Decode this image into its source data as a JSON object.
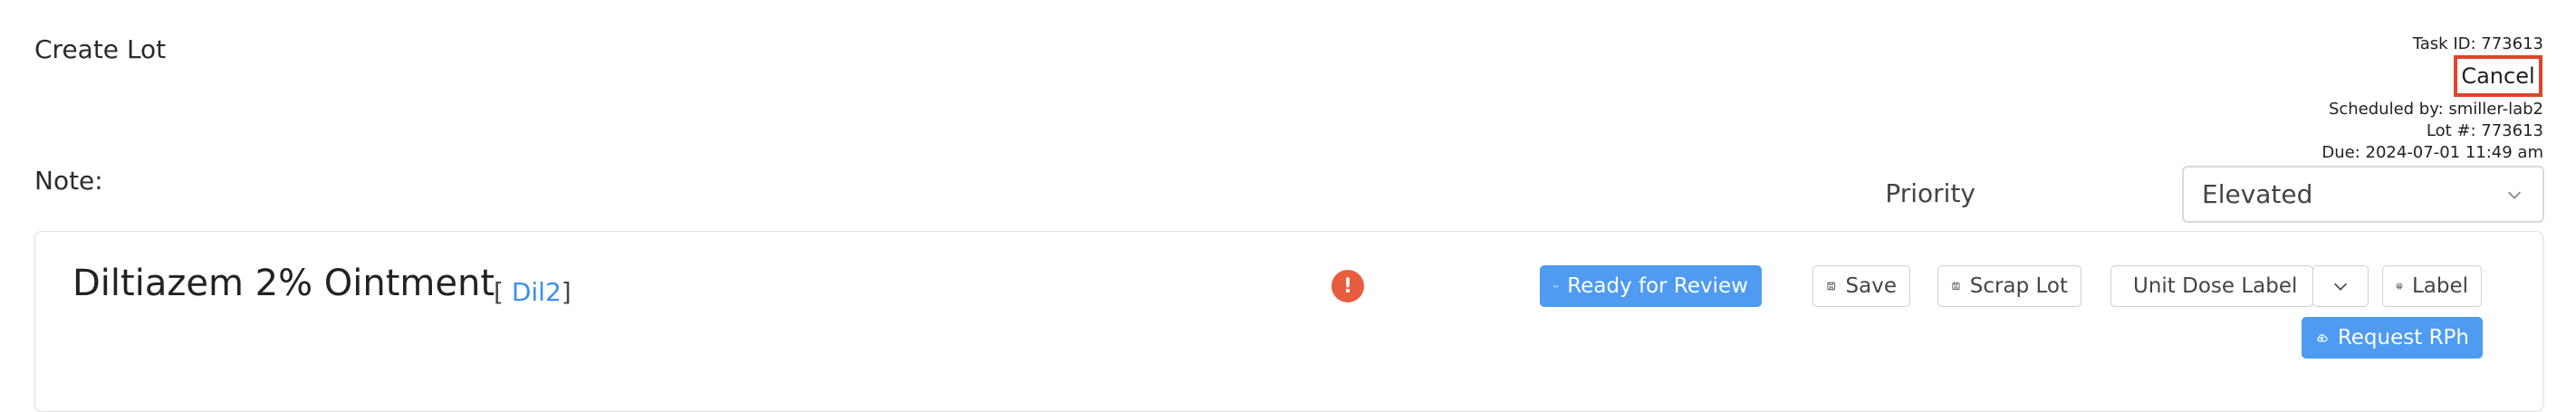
{
  "header": {
    "title": "Create Lot",
    "note_label": "Note:"
  },
  "meta": {
    "task_id": "Task ID: 773613",
    "cancel_label": "Cancel",
    "scheduled_by": "Scheduled by: smiller-lab2",
    "lot_number": "Lot #: 773613",
    "due": "Due: 2024-07-01 11:49 am"
  },
  "priority": {
    "label": "Priority",
    "value": "Elevated"
  },
  "lot": {
    "drug_name": "Diltiazem 2% Ointment",
    "code_open": "[ ",
    "code": "Dil2",
    "code_close": "]"
  },
  "actions": {
    "ready_for_review": "Ready for Review",
    "save": "Save",
    "scrap_lot": "Scrap Lot",
    "unit_dose_label": "Unit Dose Label",
    "label": "Label",
    "request_rph": "Request RPh"
  },
  "icons": {
    "alert": "alert-icon",
    "review": "glasses-icon",
    "save": "floppy-icon",
    "scrap": "floppy-icon",
    "dropdown": "chevron-down-icon",
    "label": "printer-icon",
    "request": "cloud-icon"
  },
  "colors": {
    "primary": "#4e9bf1",
    "alert": "#e85d3e",
    "cancel_border": "#e0442a",
    "link": "#3d8ef0"
  }
}
